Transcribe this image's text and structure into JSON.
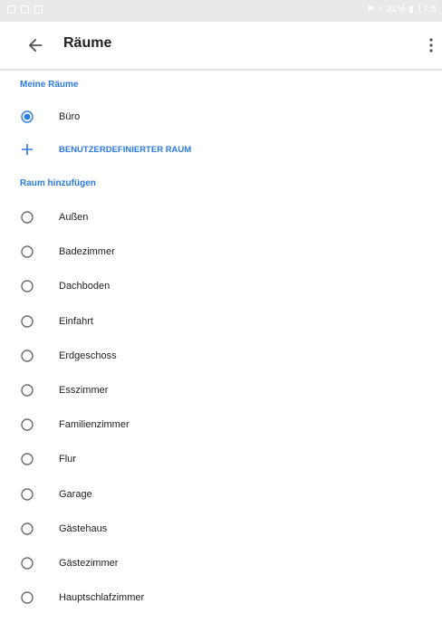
{
  "status_bar": {
    "right_text": "⚑ ▿ 25% ▮ 17:5"
  },
  "app_bar": {
    "title": "Räume",
    "back_icon": "arrow-back-icon",
    "menu_icon": "more-vert-icon"
  },
  "my_rooms": {
    "header": "Meine Räume",
    "items": [
      {
        "label": "Büro",
        "selected": true
      }
    ],
    "add_custom_label": "BENUTZERDEFINIERTER RAUM"
  },
  "add_room": {
    "header": "Raum hinzufügen",
    "items": [
      {
        "label": "Außen"
      },
      {
        "label": "Badezimmer"
      },
      {
        "label": "Dachboden"
      },
      {
        "label": "Einfahrt"
      },
      {
        "label": "Erdgeschoss"
      },
      {
        "label": "Esszimmer"
      },
      {
        "label": "Familienzimmer"
      },
      {
        "label": "Flur"
      },
      {
        "label": "Garage"
      },
      {
        "label": "Gästehaus"
      },
      {
        "label": "Gästezimmer"
      },
      {
        "label": "Hauptschlafzimmer"
      }
    ]
  },
  "colors": {
    "accent": "#2a7ae2",
    "text": "#212121",
    "radio_unselected": "#6b6b6b"
  }
}
